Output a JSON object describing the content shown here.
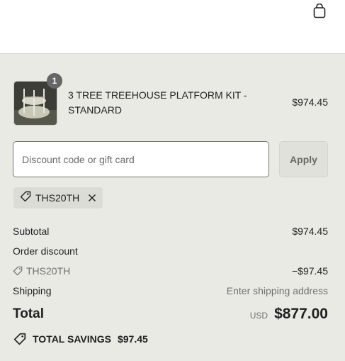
{
  "header": {
    "cart_icon": "shopping-bag-icon"
  },
  "item": {
    "quantity": "1",
    "name": "3 TREE TREEHOUSE PLATFORM KIT - STANDARD",
    "price": "$974.45"
  },
  "discount": {
    "placeholder": "Discount code or gift card",
    "value": "",
    "apply_label": "Apply",
    "applied_code": "THS20TH"
  },
  "summary": {
    "subtotal_label": "Subtotal",
    "subtotal_value": "$974.45",
    "order_discount_label": "Order discount",
    "discount_code": "THS20TH",
    "discount_value": "−$97.45",
    "shipping_label": "Shipping",
    "shipping_value": "Enter shipping address",
    "total_label": "Total",
    "currency": "USD",
    "total_value": "$877.00",
    "savings_label": "TOTAL SAVINGS",
    "savings_value": "$97.45"
  },
  "colors": {
    "background": "#eaeae5",
    "header_bg": "#ffffff",
    "text": "#1f1f1f",
    "muted_text": "#707070",
    "badge": "#666666"
  }
}
